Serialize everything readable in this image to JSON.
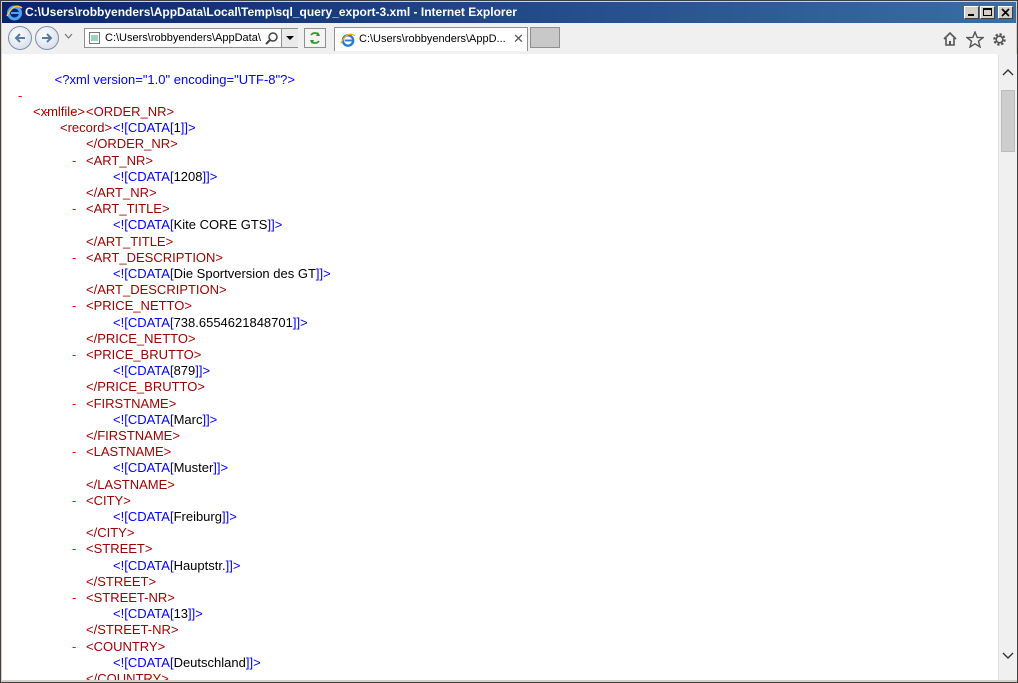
{
  "window": {
    "title": "C:\\Users\\robbyenders\\AppData\\Local\\Temp\\sql_query_export-3.xml - Internet Explorer"
  },
  "toolbar": {
    "address_value": "C:\\Users\\robbyenders\\AppData\\",
    "tab_label": "C:\\Users\\robbyenders\\AppD...",
    "tab_close": "✕"
  },
  "icons": {
    "app": "ie-logo-icon",
    "back": "back-arrow-icon",
    "forward": "forward-arrow-icon",
    "search": "search-icon",
    "refresh": "refresh-icon",
    "home": "home-icon",
    "favorites": "star-icon",
    "tools": "gear-icon"
  },
  "colors": {
    "tag": "#990000",
    "pi": "#0000ff",
    "minus": "#ff0000",
    "title_start": "#0a246a",
    "title_end": "#3a6ea5"
  },
  "xml": {
    "declaration": "<?xml version=\"1.0\" encoding=\"UTF-8\"?>",
    "root_open": "<xmlfile>",
    "record_open": "<record>",
    "minus": "-",
    "fields": [
      {
        "open": "<ORDER_NR>",
        "cdata_value": "1",
        "close": "</ORDER_NR>"
      },
      {
        "open": "<ART_NR>",
        "cdata_value": "1208",
        "close": "</ART_NR>"
      },
      {
        "open": "<ART_TITLE>",
        "cdata_value": "Kite CORE GTS",
        "close": "</ART_TITLE>"
      },
      {
        "open": "<ART_DESCRIPTION>",
        "cdata_value": "Die Sportversion des GT",
        "close": "</ART_DESCRIPTION>"
      },
      {
        "open": "<PRICE_NETTO>",
        "cdata_value": "738.6554621848701",
        "close": "</PRICE_NETTO>"
      },
      {
        "open": "<PRICE_BRUTTO>",
        "cdata_value": "879",
        "close": "</PRICE_BRUTTO>"
      },
      {
        "open": "<FIRSTNAME>",
        "cdata_value": "Marc",
        "close": "</FIRSTNAME>"
      },
      {
        "open": "<LASTNAME>",
        "cdata_value": "Muster",
        "close": "</LASTNAME>"
      },
      {
        "open": "<CITY>",
        "cdata_value": "Freiburg",
        "close": "</CITY>"
      },
      {
        "open": "<STREET>",
        "cdata_value": "Hauptstr.",
        "close": "</STREET>"
      },
      {
        "open": "<STREET-NR>",
        "cdata_value": "13",
        "close": "</STREET-NR>"
      },
      {
        "open": "<COUNTRY>",
        "cdata_value": "Deutschland",
        "close": "</COUNTRY>"
      }
    ],
    "cdata_open": "<![CDATA[",
    "cdata_close": "]]>"
  }
}
